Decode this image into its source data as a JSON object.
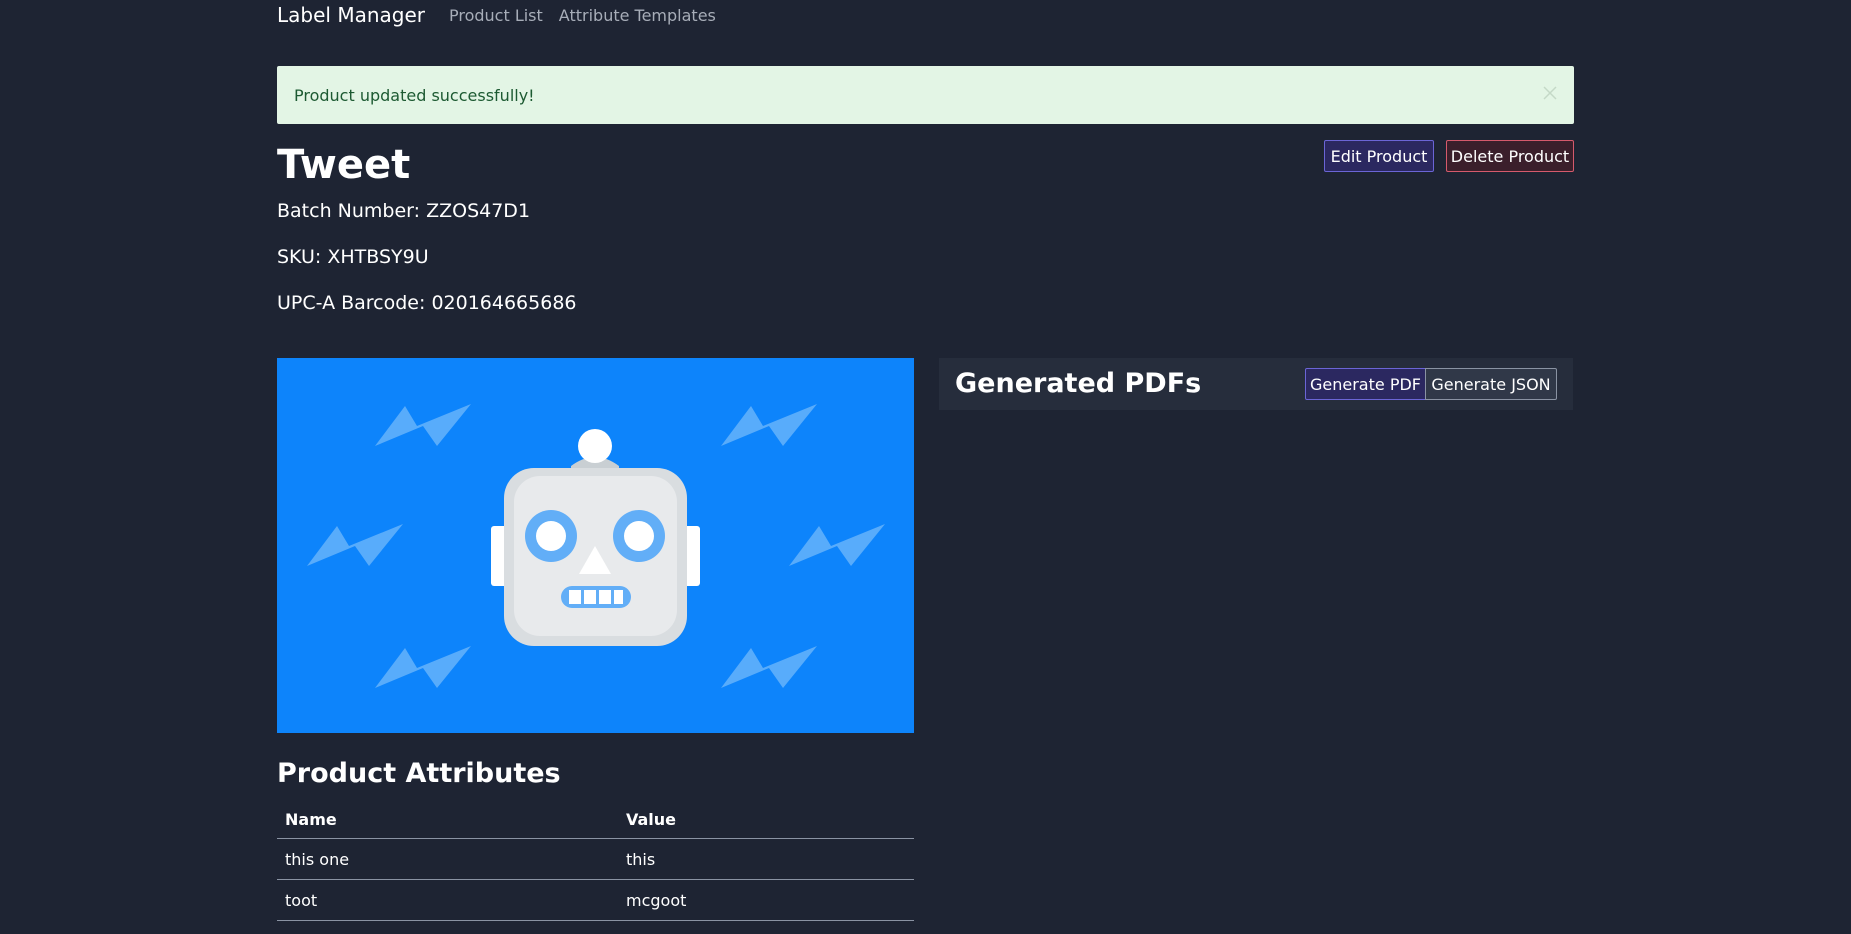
{
  "nav": {
    "brand": "Label Manager",
    "links": [
      "Product List",
      "Attribute Templates"
    ]
  },
  "alert": {
    "message": "Product updated successfully!",
    "close_icon": "close-icon"
  },
  "product": {
    "name": "Tweet",
    "batch_number": "Batch Number: ZZOS47D1",
    "sku": "SKU: XHTBSY9U",
    "upc": "UPC-A Barcode: 020164665686",
    "image_icon": "robot-icon"
  },
  "actions": {
    "edit_label": "Edit Product",
    "delete_label": "Delete Product"
  },
  "pdfs": {
    "title": "Generated PDFs",
    "generate_pdf_label": "Generate PDF",
    "generate_json_label": "Generate JSON"
  },
  "attributes": {
    "title": "Product Attributes",
    "columns": [
      "Name",
      "Value"
    ],
    "rows": [
      {
        "name": "this one",
        "value": "this"
      },
      {
        "name": "toot",
        "value": "mcgoot"
      }
    ]
  },
  "colors": {
    "background": "#1e2433",
    "alert_bg": "#e3f5e5",
    "image_bg": "#0d84fb",
    "edit_border": "#6b65d6",
    "delete_border": "#d65a6c"
  }
}
